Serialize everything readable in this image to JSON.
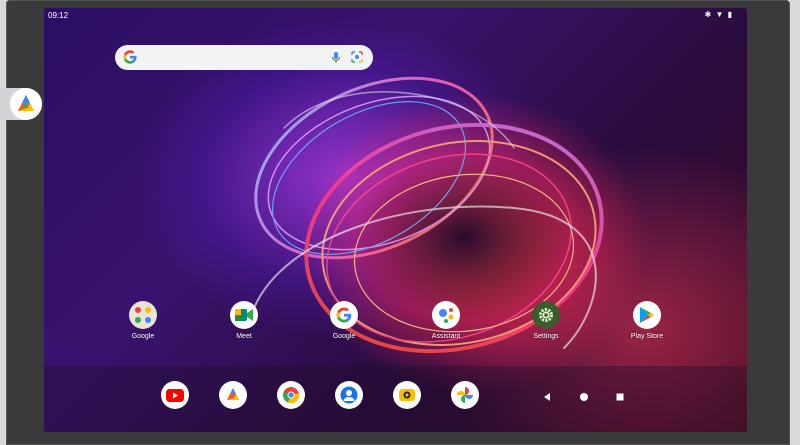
{
  "status_bar": {
    "time": "09:12",
    "icons": [
      "bluetooth-icon",
      "wifi-icon",
      "battery-icon"
    ]
  },
  "search": {
    "logo": "google-g-icon",
    "icons": [
      "mic-icon",
      "lens-icon"
    ]
  },
  "side_panel": {
    "icon": "google-one-icon"
  },
  "apps": [
    {
      "label": "Google",
      "icon": "google-folder-icon"
    },
    {
      "label": "Meet",
      "icon": "meet-icon"
    },
    {
      "label": "Google",
      "icon": "google-icon"
    },
    {
      "label": "Assistant",
      "icon": "assistant-icon"
    },
    {
      "label": "Settings",
      "icon": "settings-icon"
    },
    {
      "label": "Play Store",
      "icon": "play-store-icon"
    }
  ],
  "dock": [
    "youtube-icon",
    "google-one-icon",
    "chrome-icon",
    "contacts-icon",
    "camera-icon",
    "photos-icon"
  ],
  "nav": [
    "back-icon",
    "home-icon",
    "recents-icon"
  ],
  "colors": {
    "accent_pink": "#ff3a8c",
    "accent_orange": "#ff7a2e",
    "accent_purple": "#7a3ae0"
  }
}
